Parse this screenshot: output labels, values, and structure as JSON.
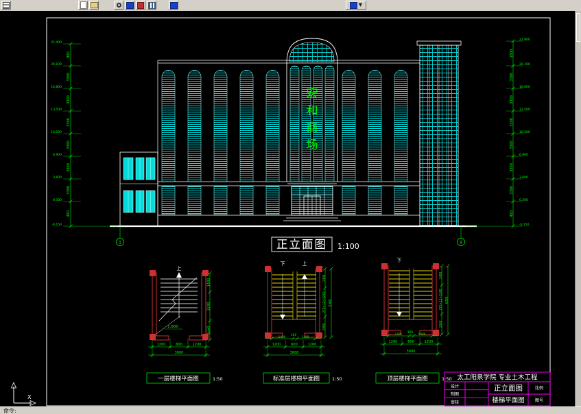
{
  "colors": {
    "glass": "#00dcdc",
    "annotation_green": "#00ff00",
    "stair_wall_red": "#cc3030",
    "stair_tread_yellow": "#ffee00",
    "titleblock_magenta": "#ff00ff",
    "background": "#000000",
    "chrome": "#d4d0c8"
  },
  "toolbar": {
    "icons": [
      "menu-icon",
      "new-icon",
      "open-icon",
      "zoom-icon",
      "pan-icon",
      "redraw-icon",
      "layers-icon",
      "properties-icon",
      "plot-style-dropdown"
    ],
    "dropdown_arrow": "▼"
  },
  "statusbar": {
    "command_label": "命令:"
  },
  "ucs": {
    "x_label": "X"
  },
  "drawing": {
    "elevation": {
      "title": "正立面图",
      "scale": "1:100",
      "sign_chars": [
        "宏",
        "和",
        "商",
        "场"
      ],
      "axis_left": "1",
      "axis_right": "9",
      "dims_left": [
        "900",
        "3300",
        "3300",
        "3300",
        "3300",
        "3300",
        "3300",
        "450"
      ],
      "levels_left": [
        "21.000",
        "20.100",
        "16.800",
        "13.500",
        "10.200",
        "6.900",
        "3.600",
        "0.300",
        "-0.150"
      ],
      "dims_right": [
        "1800",
        "3300",
        "3300",
        "3300",
        "3300",
        "3300",
        "3300",
        "450"
      ],
      "levels_right": [
        "21.900",
        "20.100",
        "16.800",
        "13.500",
        "10.200",
        "6.900",
        "3.600",
        "0.300",
        "-0.150"
      ]
    },
    "stairs": [
      {
        "label": "一层楼梯平面图",
        "scale": "1:50",
        "dir_up": "上",
        "note": "1.800",
        "bottom_dims": [
          "1200",
          "600",
          "1200"
        ],
        "bottom_total": "3000",
        "side_dims": [
          "1400",
          "3240",
          "1660"
        ]
      },
      {
        "label": "标准层楼梯平面图",
        "scale": "1:50",
        "dir_up": "上",
        "dir_down": "下",
        "mini_dims": [
          "1400",
          "100",
          "1400"
        ],
        "bottom_dims": [
          "1200",
          "600",
          "1200"
        ],
        "bottom_total": "3000",
        "side_dims": [
          "1400",
          "270×12=3240",
          "1660"
        ],
        "side_total": "6300"
      },
      {
        "label": "顶层楼梯平面图",
        "scale": "1:50",
        "dir_down": "下",
        "mini_dims": [
          "1400",
          "100",
          "1400"
        ],
        "bottom_dims": [
          "1200",
          "600",
          "1200"
        ],
        "bottom_total": "3000",
        "side_dims": [
          "1400",
          "270×12=3240",
          "1660"
        ],
        "side_total": "6300"
      }
    ],
    "titleblock": {
      "header": "太工阳泉学院 专业土木工程",
      "row_labels": [
        "设计",
        "制图",
        "审核"
      ],
      "drawing_name_1": "正立面图",
      "drawing_name_2": "楼梯平面图",
      "right_labels": [
        "比例",
        "图号"
      ]
    }
  }
}
